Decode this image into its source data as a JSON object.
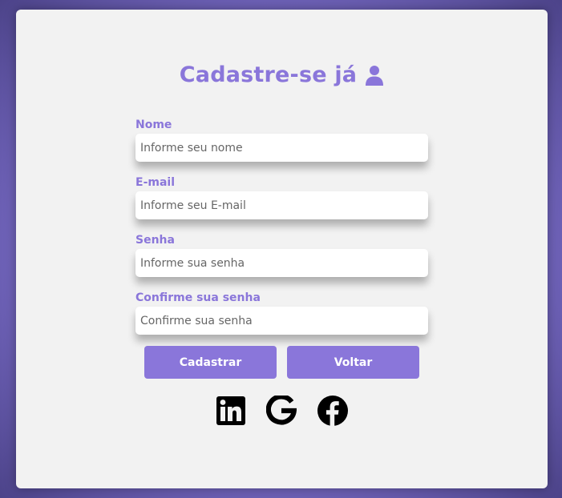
{
  "form": {
    "title": "Cadastre-se já",
    "title_icon": "user-icon",
    "fields": [
      {
        "label": "Nome",
        "placeholder": "Informe seu nome",
        "value": ""
      },
      {
        "label": "E-mail",
        "placeholder": "Informe seu E-mail",
        "value": ""
      },
      {
        "label": "Senha",
        "placeholder": "Informe sua senha",
        "value": ""
      },
      {
        "label": "Confirme sua senha",
        "placeholder": "Confirme sua senha",
        "value": ""
      }
    ],
    "buttons": {
      "submit_label": "Cadastrar",
      "back_label": "Voltar"
    }
  },
  "socials": [
    {
      "icon": "linkedin-icon"
    },
    {
      "icon": "google-icon"
    },
    {
      "icon": "facebook-icon"
    }
  ],
  "colors": {
    "accent": "#8a76da",
    "card": "#f2f2f2",
    "background": "#7d6fcc"
  }
}
